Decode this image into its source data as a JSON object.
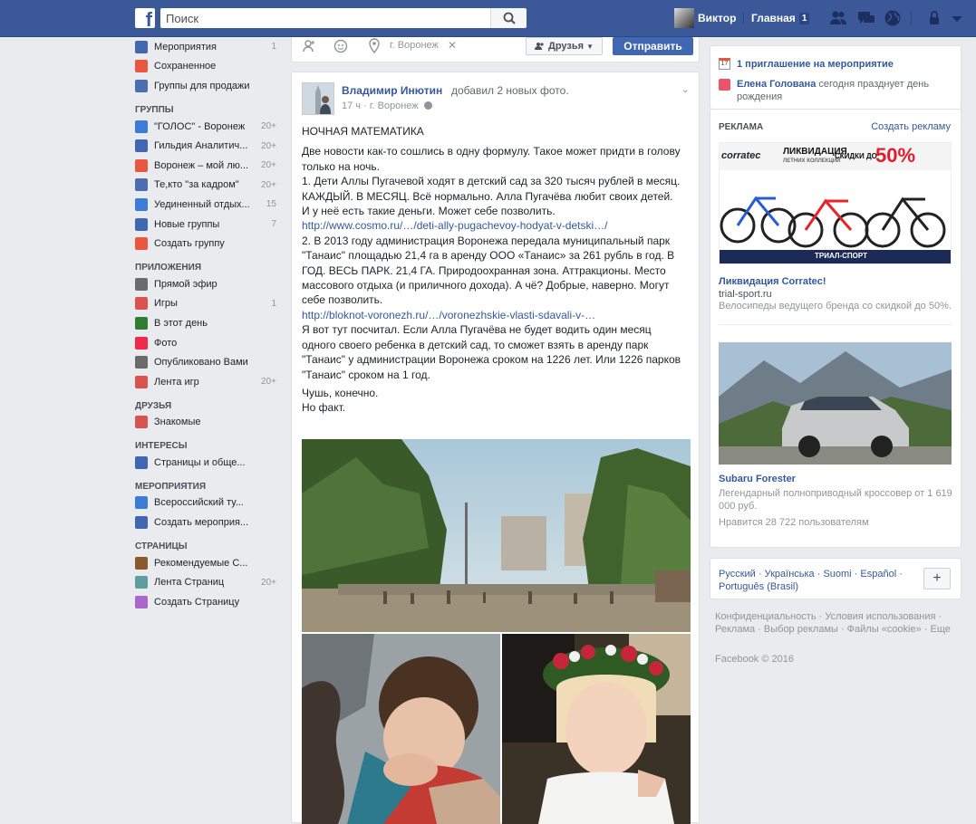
{
  "topbar": {
    "search_placeholder": "Поиск",
    "user_name": "Виктор",
    "home_label": "Главная",
    "home_badge": "1",
    "icons": [
      "friends-icon",
      "messages-icon",
      "globe-icon",
      "lock-icon"
    ]
  },
  "sidebar": {
    "top_items": [
      {
        "label": "Мероприятия",
        "count": "1",
        "icon": "calendar-icon"
      },
      {
        "label": "Сохраненное",
        "count": "",
        "icon": "bookmark-icon"
      },
      {
        "label": "Группы для продажи",
        "count": "",
        "icon": "tag-icon"
      }
    ],
    "groups_header": "ГРУППЫ",
    "groups": [
      {
        "label": "\"ГОЛОС\" - Воронеж",
        "count": "20+"
      },
      {
        "label": "Гильдия Аналитич...",
        "count": "20+"
      },
      {
        "label": "Воронеж – мой лю...",
        "count": "20+"
      },
      {
        "label": "Те,кто \"за кадром\"",
        "count": "20+"
      },
      {
        "label": "Уединенный отдых...",
        "count": "15"
      },
      {
        "label": "Новые группы",
        "count": "7"
      },
      {
        "label": "Создать группу",
        "count": ""
      }
    ],
    "apps_header": "ПРИЛОЖЕНИЯ",
    "apps": [
      {
        "label": "Прямой эфир",
        "count": ""
      },
      {
        "label": "Игры",
        "count": "1"
      },
      {
        "label": "В этот день",
        "count": ""
      },
      {
        "label": "Фото",
        "count": ""
      },
      {
        "label": "Опубликовано Вами",
        "count": ""
      },
      {
        "label": "Лента игр",
        "count": "20+"
      }
    ],
    "friends_header": "ДРУЗЬЯ",
    "friends": [
      {
        "label": "Знакомые",
        "count": ""
      }
    ],
    "interests_header": "ИНТЕРЕСЫ",
    "interests": [
      {
        "label": "Страницы и обще...",
        "count": ""
      }
    ],
    "events_header": "МЕРОПРИЯТИЯ",
    "events": [
      {
        "label": "Всероссийский ту...",
        "count": ""
      },
      {
        "label": "Создать мероприя...",
        "count": ""
      }
    ],
    "pages_header": "СТРАНИЦЫ",
    "pages": [
      {
        "label": "Рекомендуемые С...",
        "count": ""
      },
      {
        "label": "Лента Страниц",
        "count": "20+"
      },
      {
        "label": "Создать Страницу",
        "count": ""
      }
    ]
  },
  "composer": {
    "location": "г. Воронеж",
    "audience": "Друзья",
    "submit": "Отправить"
  },
  "post": {
    "author": "Владимир Инютин",
    "action": "добавил 2 новых фото.",
    "time": "17 ч",
    "location": "г. Воронеж",
    "title": "НОЧНАЯ МАТЕМАТИКА",
    "p1": "Две новости как-то сошлись в одну формулу. Такое может придти в голову только на ночь.",
    "p2": "1. Дети Аллы Пугачевой ходят в детский сад за 320 тысяч рублей в месяц. КАЖДЫЙ. В МЕСЯЦ. Всё нормально. Алла Пугачёва любит своих детей. И у неё есть такие деньги. Может себе позволить.",
    "link1": "http://www.cosmo.ru/…/deti-ally-pugachevoy-hodyat-v-detski…/",
    "p3": "2. В 2013 году администрация Воронежа передала муниципальный парк \"Танаис\" площадью 21,4 га в аренду ООО «Танаис» за 261 рубль в год. В ГОД. ВЕСЬ ПАРК. 21,4 ГА. Природоохранная зона. Аттракционы. Место массового отдыха (и приличного дохода). А чё? Добрые, наверно. Могут себе позволить.",
    "link2": "http://bloknot-voronezh.ru/…/voronezhskie-vlasti-sdavali-v-…",
    "p4": "Я вот тут посчитал. Если Алла Пугачёва не будет водить один месяц одного своего ребенка в детский сад, то сможет взять в аренду парк \"Танаис\" у администрации Воронежа сроком на 1226 лет. Или 1226 парков \"Танаис\" сроком на 1 год.",
    "p5": "Чушь, конечно.",
    "p6": "Но факт."
  },
  "right": {
    "event_invite": "1 приглашение на мероприятие",
    "birthday_name": "Елена Голована",
    "birthday_text": "сегодня празднует день рождения",
    "ads_header": "РЕКЛАМА",
    "create_ad": "Создать рекламу",
    "ad1_banner_title": "ЛИКВИДАЦИЯ",
    "ad1_banner_sub": "ЛЕТНИХ КОЛЛЕКЦИЙ",
    "ad1_banner_discount_label": "СКИДКИ ДО",
    "ad1_banner_percent": "50%",
    "ad1_banner_brand": "corratec",
    "ad1_banner_store": "ТРИАЛ-СПОРТ",
    "ad1_title": "Ликвидация Corratec!",
    "ad1_domain": "trial-sport.ru",
    "ad1_desc": "Велосипеды ведущего бренда со скидкой до 50%.",
    "ad2_title": "Subaru Forester",
    "ad2_desc": "Легендарный полноприводный кроссовер от 1 619 000 руб.",
    "ad2_likes": "Нравится 28 722 пользователям",
    "languages": "Русский · Українська · Suomi · Español · Português (Brasil)",
    "footer_links": "Конфиденциальность · Условия использования · Реклама · Выбор рекламы · Файлы «cookie» · Еще",
    "copyright": "Facebook © 2016"
  }
}
